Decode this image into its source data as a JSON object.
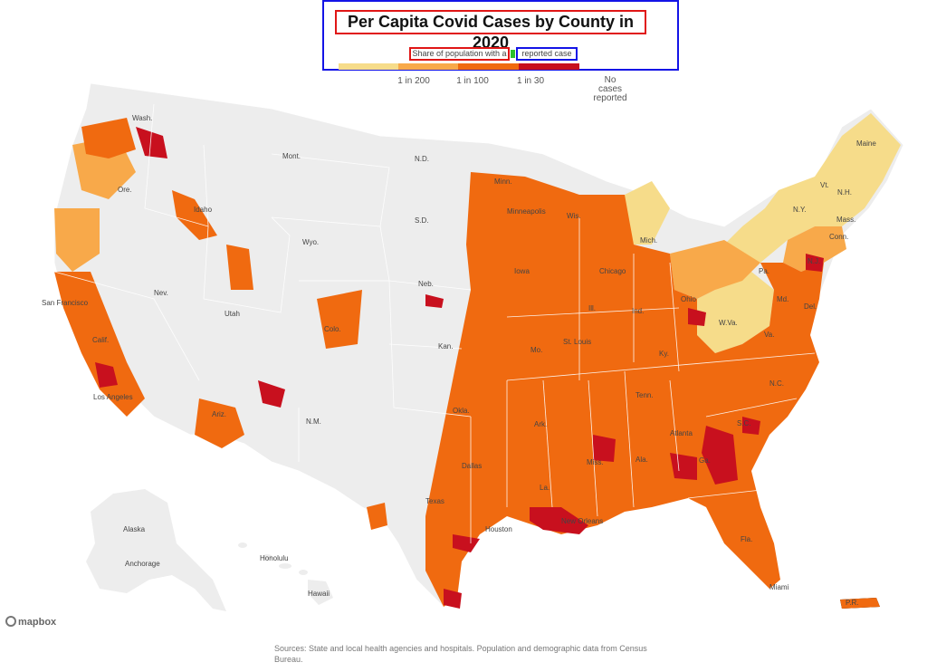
{
  "title": "Per Capita Covid Cases by County in 2020",
  "legend": {
    "subtitle_part1": "Share of population with a",
    "subtitle_part2": "reported case",
    "ticks": [
      "1 in 200",
      "1 in 100",
      "1 in 30"
    ],
    "no_cases": "No cases reported",
    "colors": [
      "#f6dc8a",
      "#f8a94a",
      "#f06a10",
      "#c8101e"
    ],
    "no_case_color": "#ededed"
  },
  "labels": {
    "wash": "Wash.",
    "ore": "Ore.",
    "idaho": "Idaho",
    "mont": "Mont.",
    "nd": "N.D.",
    "sd": "S.D.",
    "wyo": "Wyo.",
    "neb": "Neb.",
    "nev": "Nev.",
    "utah": "Utah",
    "colo": "Colo.",
    "calif": "Calif.",
    "sf": "San Francisco",
    "la": "Los Angeles",
    "ariz": "Ariz.",
    "nm": "N.M.",
    "kan": "Kan.",
    "okla": "Okla.",
    "texas": "Texas",
    "dallas": "Dallas",
    "houston": "Houston",
    "minn": "Minn.",
    "minneapolis": "Minneapolis",
    "wis": "Wis.",
    "iowa": "Iowa",
    "ill": "Ill.",
    "chicago": "Chicago",
    "mo": "Mo.",
    "stlouis": "St. Louis",
    "ark": "Ark.",
    "la_state": "La.",
    "neworleans": "New Orleans",
    "miss": "Miss.",
    "ala": "Ala.",
    "tenn": "Tenn.",
    "ky": "Ky.",
    "ind": "Ind.",
    "ohio": "Ohio",
    "mich": "Mich.",
    "pa": "Pa.",
    "wva": "W.Va.",
    "va": "Va.",
    "md": "Md.",
    "del": "Del.",
    "nj": "N.J.",
    "ny": "N.Y.",
    "conn": "Conn.",
    "mass": "Mass.",
    "vt": "Vt.",
    "nh": "N.H.",
    "maine": "Maine",
    "nc": "N.C.",
    "sc": "S.C.",
    "atlanta": "Atlanta",
    "ga": "Ga.",
    "fla": "Fla.",
    "miami": "Miami",
    "alaska": "Alaska",
    "anchorage": "Anchorage",
    "honolulu": "Honolulu",
    "hawaii": "Hawaii",
    "pr": "P.R."
  },
  "attribution": "mapbox",
  "source": "Sources: State and local health agencies and hospitals. Population and demographic data from Census Bureau."
}
